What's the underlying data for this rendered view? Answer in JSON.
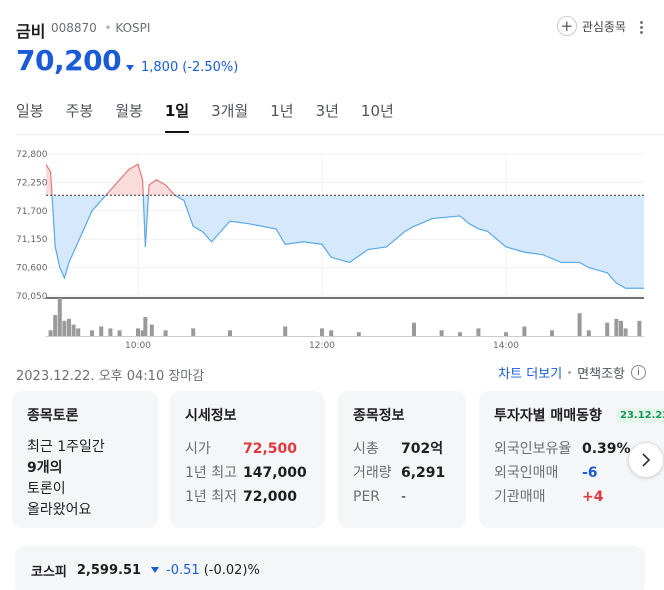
{
  "header": {
    "stock_name": "금비",
    "stock_code": "008870",
    "market": "KOSPI",
    "watchlist_label": "관심종목",
    "price": "70,200",
    "change_value": "1,800",
    "change_pct": "(-2.50%)"
  },
  "tabs": [
    {
      "label": "일봉"
    },
    {
      "label": "주봉"
    },
    {
      "label": "월봉"
    },
    {
      "label": "1일"
    },
    {
      "label": "3개월"
    },
    {
      "label": "1년"
    },
    {
      "label": "3년"
    },
    {
      "label": "10년"
    }
  ],
  "active_tab": "1일",
  "colors": {
    "up": "#e0383c",
    "down": "#1a5bd6",
    "up_fill": "#fbdcdc",
    "down_fill": "#d6e8fb",
    "line": "#5aa8e6"
  },
  "chart_data": {
    "type": "area",
    "y_tick_labels": [
      "72,800",
      "72,250",
      "71,700",
      "71,150",
      "70,600",
      "70,050"
    ],
    "ylim": [
      70050,
      72800
    ],
    "x_tick_labels": [
      "10:00",
      "12:00",
      "14:00"
    ],
    "reference_price": 72000,
    "x_start_hour": 9.0,
    "x_end_hour": 15.5,
    "price_series": [
      [
        9.0,
        72600
      ],
      [
        9.05,
        72450
      ],
      [
        9.1,
        71000
      ],
      [
        9.15,
        70600
      ],
      [
        9.2,
        70400
      ],
      [
        9.25,
        70700
      ],
      [
        9.3,
        70900
      ],
      [
        9.4,
        71300
      ],
      [
        9.5,
        71700
      ],
      [
        9.6,
        71900
      ],
      [
        9.7,
        72100
      ],
      [
        9.8,
        72300
      ],
      [
        9.9,
        72500
      ],
      [
        10.0,
        72600
      ],
      [
        10.05,
        72300
      ],
      [
        10.08,
        71000
      ],
      [
        10.12,
        72200
      ],
      [
        10.2,
        72300
      ],
      [
        10.3,
        72200
      ],
      [
        10.4,
        72000
      ],
      [
        10.5,
        71900
      ],
      [
        10.6,
        71400
      ],
      [
        10.7,
        71300
      ],
      [
        10.8,
        71100
      ],
      [
        11.0,
        71500
      ],
      [
        11.2,
        71450
      ],
      [
        11.5,
        71350
      ],
      [
        11.6,
        71050
      ],
      [
        11.8,
        71100
      ],
      [
        12.0,
        71050
      ],
      [
        12.1,
        70800
      ],
      [
        12.3,
        70700
      ],
      [
        12.5,
        70950
      ],
      [
        12.7,
        71000
      ],
      [
        12.9,
        71300
      ],
      [
        13.0,
        71400
      ],
      [
        13.2,
        71550
      ],
      [
        13.5,
        71600
      ],
      [
        13.6,
        71450
      ],
      [
        13.7,
        71350
      ],
      [
        13.8,
        71300
      ],
      [
        14.0,
        71000
      ],
      [
        14.2,
        70900
      ],
      [
        14.4,
        70850
      ],
      [
        14.6,
        70700
      ],
      [
        14.8,
        70700
      ],
      [
        14.9,
        70600
      ],
      [
        15.0,
        70550
      ],
      [
        15.1,
        70500
      ],
      [
        15.2,
        70300
      ],
      [
        15.3,
        70200
      ],
      [
        15.5,
        70200
      ]
    ],
    "volume_series": [
      [
        9.05,
        0.15
      ],
      [
        9.1,
        0.55
      ],
      [
        9.15,
        1.0
      ],
      [
        9.2,
        0.4
      ],
      [
        9.25,
        0.45
      ],
      [
        9.3,
        0.3
      ],
      [
        9.35,
        0.2
      ],
      [
        9.5,
        0.15
      ],
      [
        9.6,
        0.25
      ],
      [
        9.7,
        0.2
      ],
      [
        9.8,
        0.15
      ],
      [
        10.0,
        0.2
      ],
      [
        10.05,
        0.15
      ],
      [
        10.08,
        0.5
      ],
      [
        10.15,
        0.3
      ],
      [
        10.3,
        0.15
      ],
      [
        10.6,
        0.2
      ],
      [
        11.0,
        0.15
      ],
      [
        11.6,
        0.25
      ],
      [
        12.0,
        0.2
      ],
      [
        12.1,
        0.15
      ],
      [
        12.4,
        0.1
      ],
      [
        13.0,
        0.35
      ],
      [
        13.3,
        0.15
      ],
      [
        13.5,
        0.1
      ],
      [
        13.7,
        0.2
      ],
      [
        14.0,
        0.1
      ],
      [
        14.2,
        0.25
      ],
      [
        14.5,
        0.15
      ],
      [
        14.8,
        0.6
      ],
      [
        14.9,
        0.15
      ],
      [
        15.1,
        0.35
      ],
      [
        15.2,
        0.45
      ],
      [
        15.25,
        0.4
      ],
      [
        15.3,
        0.2
      ],
      [
        15.45,
        0.4
      ]
    ]
  },
  "timestamp": "2023.12.22. 오후 04:10 장마감",
  "links": {
    "more_chart": "차트 더보기",
    "exempt": "면책조항",
    "info_icon": "i"
  },
  "cards": {
    "forum": {
      "title": "종목토론",
      "line1": "최근 1주일간",
      "line2": "9개의",
      "line3": "토론이",
      "line4": "올라왔어요"
    },
    "quote": {
      "title": "시세정보",
      "rows": [
        {
          "label": "시가",
          "value": "72,500"
        },
        {
          "label": "1년 최고",
          "value": "147,000"
        },
        {
          "label": "1년 최저",
          "value": "72,000"
        }
      ]
    },
    "stock_info": {
      "title": "종목정보",
      "rows": [
        {
          "label": "시총",
          "value": "702억"
        },
        {
          "label": "거래량",
          "value": "6,291"
        },
        {
          "label": "PER",
          "value": "-"
        }
      ]
    },
    "investor": {
      "title": "투자자별 매매동향",
      "date": "23.12.22",
      "rows": [
        {
          "label": "외국인보유율",
          "value": "0.39%"
        },
        {
          "label": "외국인매매",
          "value": "-6"
        },
        {
          "label": "기관매매",
          "value": "+4"
        }
      ]
    }
  },
  "index": {
    "name": "코스피",
    "value": "2,599.51",
    "change": "-0.51",
    "pct": "(-0.02)%"
  }
}
